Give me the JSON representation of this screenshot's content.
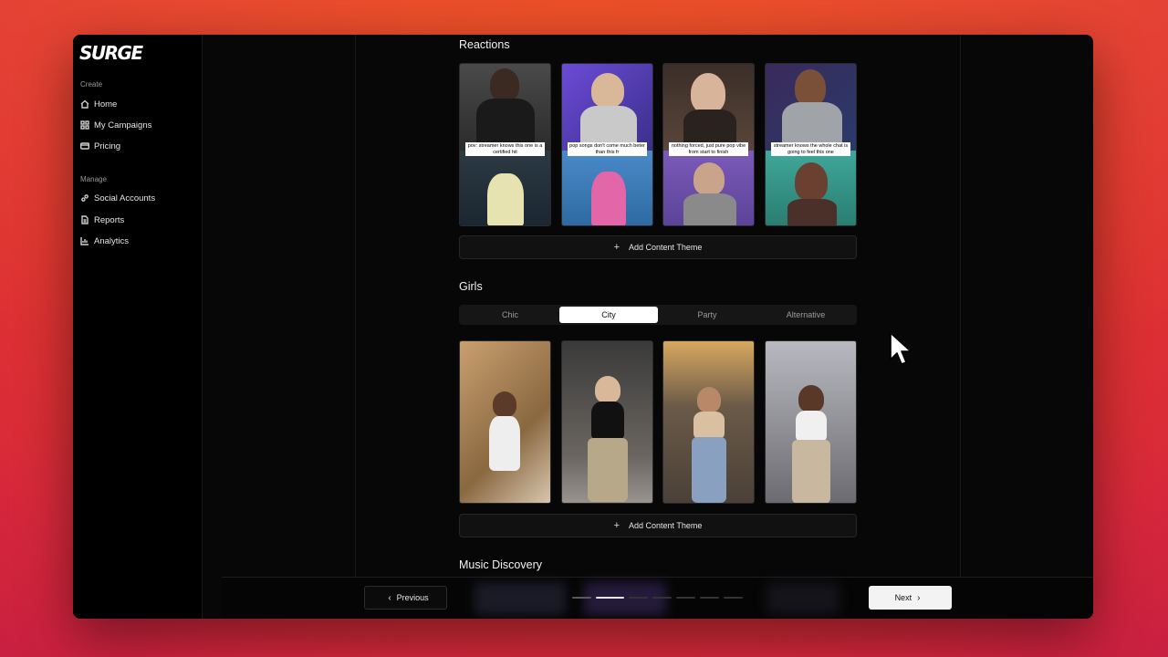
{
  "app": {
    "logo": "SURGE"
  },
  "sidebar": {
    "create_label": "Create",
    "create_items": [
      {
        "label": "Home",
        "icon": "home-icon"
      },
      {
        "label": "My Campaigns",
        "icon": "grid-icon"
      },
      {
        "label": "Pricing",
        "icon": "credit-card-icon"
      }
    ],
    "manage_label": "Manage",
    "manage_items": [
      {
        "label": "Social Accounts",
        "icon": "link-icon"
      },
      {
        "label": "Reports",
        "icon": "document-icon"
      },
      {
        "label": "Analytics",
        "icon": "bar-chart-icon"
      }
    ]
  },
  "reactions": {
    "title": "Reactions",
    "thumbnails": [
      {
        "caption": "pov: streamer knows this one is a certified hit"
      },
      {
        "caption": "pop songs don't come much beter than this fr"
      },
      {
        "caption": "nothing forced, just pure pop vibe from start to finish"
      },
      {
        "caption": "streamer knows the whole chat is going to feel this one"
      }
    ],
    "add_label": "Add Content Theme"
  },
  "girls": {
    "title": "Girls",
    "tabs": [
      "Chic",
      "City",
      "Party",
      "Alternative"
    ],
    "active_tab": "City",
    "add_label": "Add Content Theme"
  },
  "music_discovery": {
    "title": "Music Discovery"
  },
  "footer": {
    "prev_label": "Previous",
    "next_label": "Next",
    "progress": {
      "total_steps": 8,
      "current_step": 2
    }
  },
  "colors": {
    "accent_bg": "#e23b2a",
    "window_bg": "#070707",
    "active_tab_bg": "#ffffff"
  }
}
